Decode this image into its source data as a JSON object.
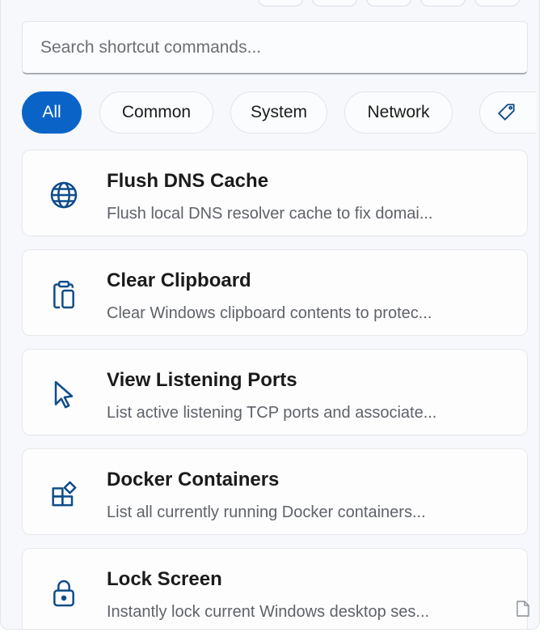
{
  "search": {
    "placeholder": "Search shortcut commands..."
  },
  "filters": {
    "all": "All",
    "common": "Common",
    "system": "System",
    "network": "Network",
    "tag_icon": "tag-icon"
  },
  "commands": [
    {
      "title": "Flush DNS Cache",
      "desc": "Flush local DNS resolver cache to fix domai...",
      "icon": "globe-icon"
    },
    {
      "title": "Clear Clipboard",
      "desc": "Clear Windows clipboard contents to protec...",
      "icon": "clipboard-icon"
    },
    {
      "title": "View Listening Ports",
      "desc": "List active listening TCP ports and associate...",
      "icon": "cursor-icon"
    },
    {
      "title": "Docker Containers",
      "desc": "List all currently running Docker containers...",
      "icon": "apps-icon"
    },
    {
      "title": "Lock Screen",
      "desc": "Instantly lock current Windows desktop ses...",
      "icon": "lock-icon"
    }
  ],
  "colors": {
    "accent": "#0a64c8",
    "icon": "#0f4c8a",
    "background": "#f6f8fb"
  }
}
